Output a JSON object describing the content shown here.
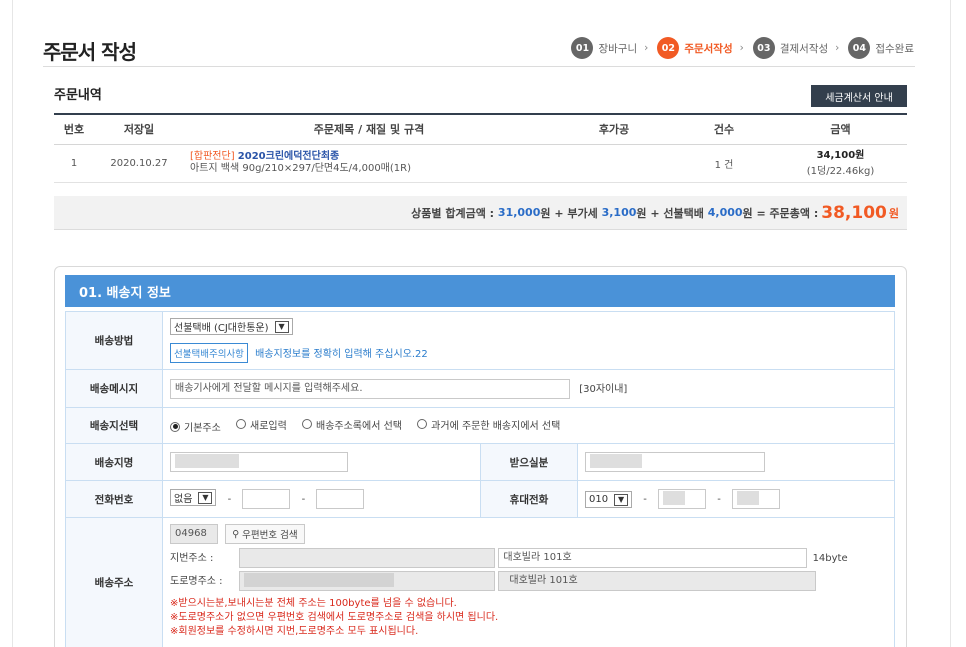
{
  "page_title": "주문서 작성",
  "steps": [
    {
      "num": "01",
      "label": "장바구니"
    },
    {
      "num": "02",
      "label": "주문서작성"
    },
    {
      "num": "03",
      "label": "결제서작성"
    },
    {
      "num": "04",
      "label": "접수완료"
    }
  ],
  "order": {
    "section_title": "주문내역",
    "tax_button": "세금계산서 안내",
    "headers": [
      "번호",
      "저장일",
      "주문제목 / 재질 및 규격",
      "후가공",
      "건수",
      "금액"
    ],
    "row": {
      "no": "1",
      "date": "2020.10.27",
      "tag": "[합판전단]",
      "product": "2020크린에덕전단최종",
      "spec": "아트지 백색 90g/210×297/단면4도/4,000매(1R)",
      "postprocess": "",
      "count": "1 건",
      "amount": "34,100원",
      "amount_sub": "(1덩/22.46kg)"
    },
    "summary": {
      "label_goods": "상품별 합계금액 :",
      "goods": "31,000",
      "won": "원",
      "plus_vat": "+ 부가세",
      "vat": "3,100",
      "plus_ship": "+ 선불택배",
      "ship": "4,000",
      "equals_total": "= 주문총액 :",
      "total": "38,100"
    }
  },
  "shipping": {
    "section_title": "01. 배송지 정보",
    "method_label": "배송방법",
    "method_value": "선불택배 (CJ대한통운)",
    "method_note_button": "선불택배주의사항",
    "method_note": "배송지정보를 정확히 입력해 주십시오.22",
    "message_label": "배송메시지",
    "message_placeholder": "배송기사에게 전달할 메시지를 입력해주세요.",
    "message_limit": "[30자이내]",
    "select_label": "배송지선택",
    "options": [
      "기본주소",
      "새로입력",
      "배송주소록에서 선택",
      "과거에 주문한 배송지에서 선택"
    ],
    "name_label": "배송지명",
    "receiver_label": "받으실분",
    "phone_label": "전화번호",
    "phone_prefix": "없음",
    "mobile_label": "휴대전화",
    "mobile_prefix": "010",
    "dash": "-",
    "address_label": "배송주소",
    "postcode": "04968",
    "postcode_button": "우편번호 검색",
    "jibun_label": "지번주소 :",
    "road_label": "도로명주소 :",
    "detail_address": "대호빌라 101호",
    "byte_count": "14byte",
    "warnings": [
      "※받으시는분,보내시는분 전체 주소는 100byte를 넘을 수 없습니다.",
      "※도로명주소가 없으면 우편번호 검색에서 도로명주소로 검색을 하시면 됩니다.",
      "※회원정보를 수정하시면 지번,도로명주소 모두 표시됩니다."
    ]
  },
  "colors": {
    "accent": "#f15a24",
    "header_blue": "#4a92d8",
    "dark_button": "#333f4d"
  }
}
